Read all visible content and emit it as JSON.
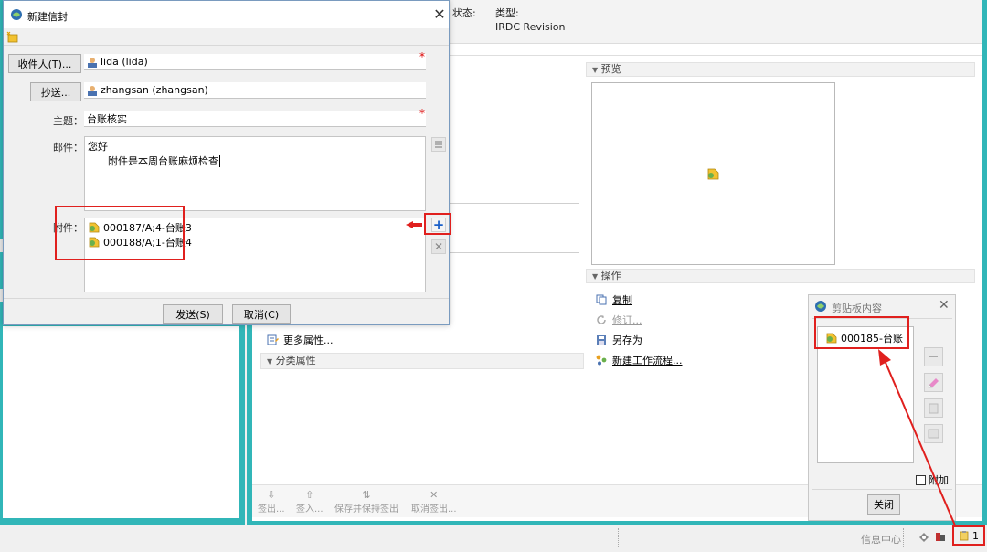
{
  "header": {
    "status_label": "状态:",
    "type_label": "类型:",
    "type_value": "IRDC Revision"
  },
  "preview_panel": {
    "title": "预览"
  },
  "operations_panel": {
    "title": "操作",
    "items": [
      {
        "label": "复制",
        "icon": "copy-icon",
        "enabled": true
      },
      {
        "label": "修订...",
        "icon": "revise-icon",
        "enabled": false
      },
      {
        "label": "另存为",
        "icon": "save-as-icon",
        "enabled": true
      },
      {
        "label": "新建工作流程...",
        "icon": "workflow-icon",
        "enabled": true
      }
    ]
  },
  "more_properties_link": "更多属性...",
  "classification_panel": {
    "title": "分类属性"
  },
  "bottom_toolbar": [
    {
      "label": "签出...",
      "icon": "check-out-icon"
    },
    {
      "label": "签入...",
      "icon": "check-in-icon"
    },
    {
      "label": "保存并保持签出",
      "icon": "save-keep-checkout-icon"
    },
    {
      "label": "取消签出...",
      "icon": "cancel-checkout-icon"
    }
  ],
  "status_bar": {
    "info_center": "信息中心",
    "notification_count": "1"
  },
  "dialog": {
    "title": "新建信封",
    "to_button": "收件人(T)...",
    "to_value": "lida (lida)",
    "cc_button": "抄送...",
    "cc_value": "zhangsan (zhangsan)",
    "subject_label": "主题：",
    "subject_value": "台账核实",
    "mail_label": "邮件：",
    "mail_line1": "您好",
    "mail_line2": "附件是本周台账麻烦检查",
    "attach_label": "附件：",
    "attachments": [
      "000187/A;4-台账3",
      "000188/A;1-台账4"
    ],
    "send_button": "发送(S)",
    "cancel_button": "取消(C)"
  },
  "clipboard_panel": {
    "title": "剪贴板内容",
    "items": [
      "000185-台账"
    ],
    "append_label": "附加",
    "close_button": "关闭"
  },
  "colors": {
    "frame_teal": "#31b6b8",
    "highlight_red": "#e0201e",
    "required_red": "#d00000"
  }
}
